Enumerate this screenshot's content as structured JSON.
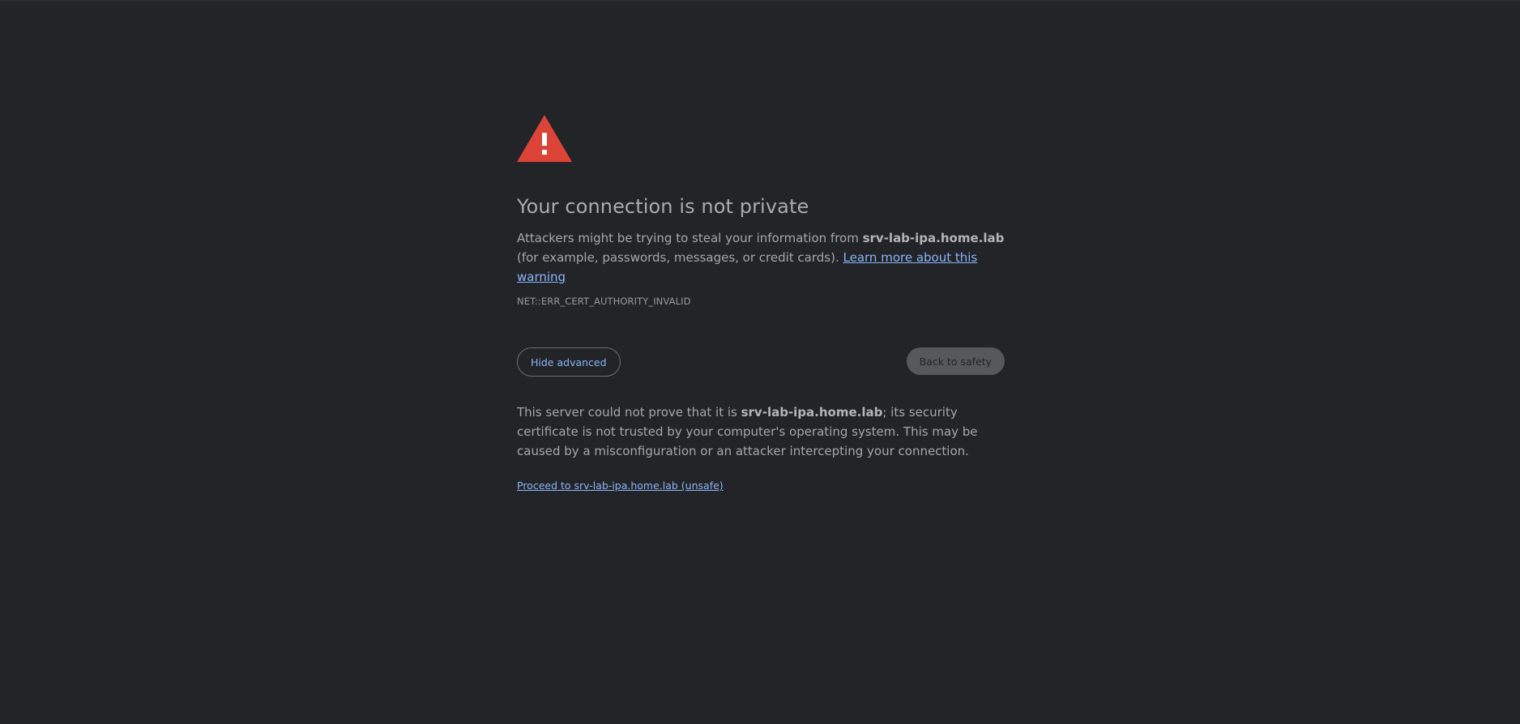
{
  "colors": {
    "background": "#232428",
    "warning_icon": "#db4437",
    "link": "#8ab4f8",
    "disabled_button": "#56585c"
  },
  "icon": {
    "name": "warning-triangle-icon"
  },
  "heading": "Your connection is not private",
  "main_message": {
    "prefix": "Attackers might be trying to steal your information from ",
    "host": "srv-lab-ipa.home.lab",
    "suffix": " (for example, passwords, messages, or credit cards). ",
    "learn_more_link": "Learn more about this warning"
  },
  "error_code": "NET::ERR_CERT_AUTHORITY_INVALID",
  "buttons": {
    "hide_advanced": "Hide advanced",
    "back_to_safety": "Back to safety"
  },
  "details": {
    "prefix": "This server could not prove that it is ",
    "host": "srv-lab-ipa.home.lab",
    "suffix": "; its security certificate is not trusted by your computer's operating system. This may be caused by a misconfiguration or an attacker intercepting your connection.",
    "proceed_link": "Proceed to srv-lab-ipa.home.lab (unsafe)"
  }
}
